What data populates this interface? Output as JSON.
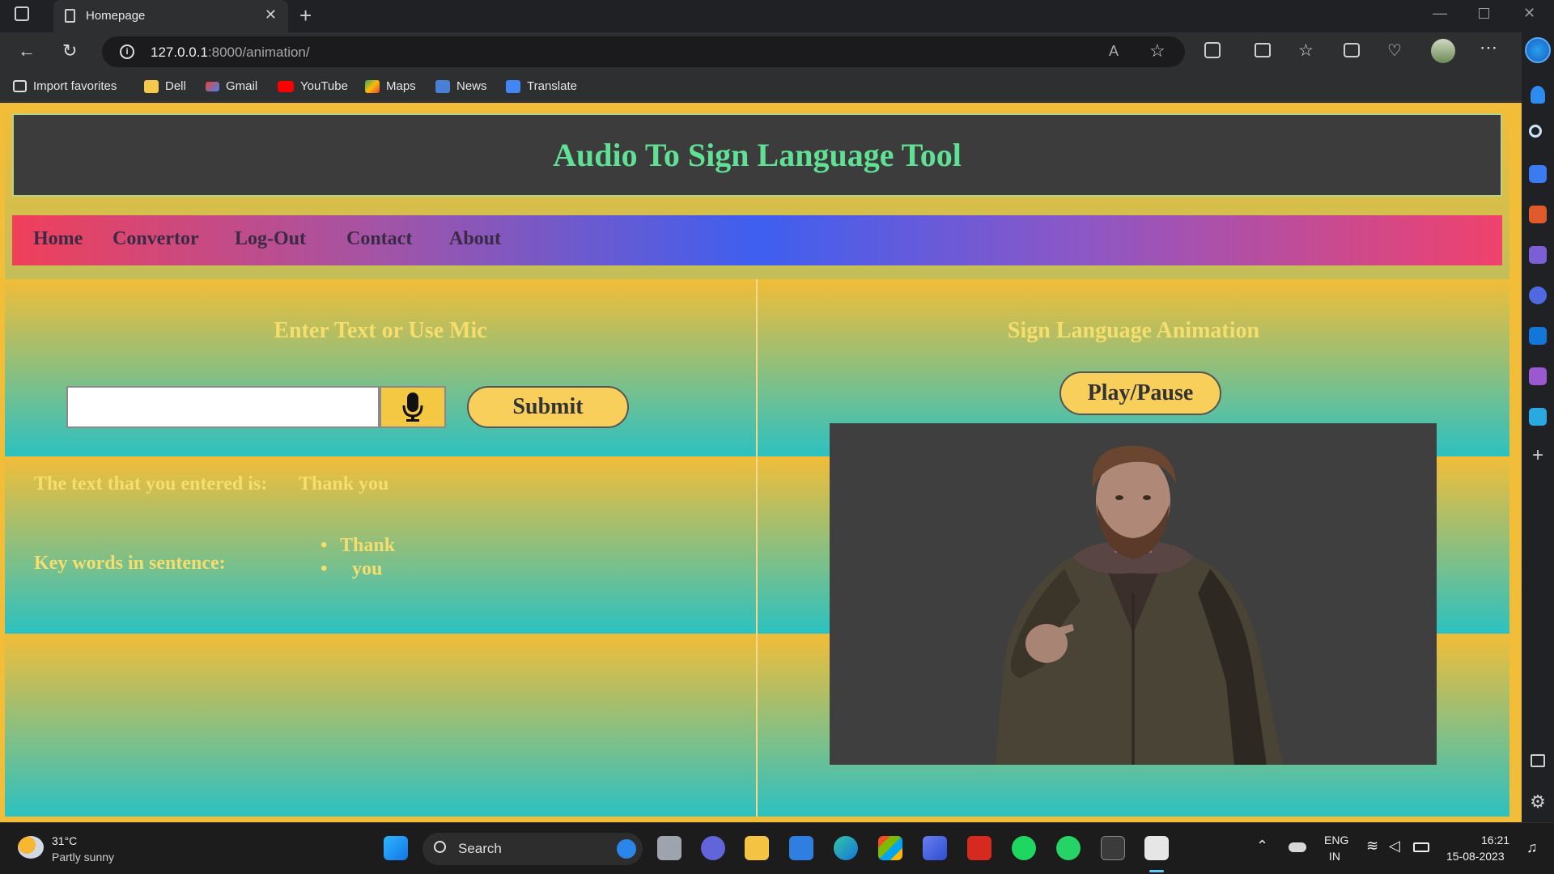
{
  "browser": {
    "tab_title": "Homepage",
    "url_host": "127.0.0.1",
    "url_path": ":8000/animation/",
    "bookmarks": [
      "Import favorites",
      "Dell",
      "Gmail",
      "YouTube",
      "Maps",
      "News",
      "Translate"
    ]
  },
  "site": {
    "title": "Audio To Sign Language Tool",
    "nav": [
      "Home",
      "Convertor",
      "Log-Out",
      "Contact",
      "About"
    ]
  },
  "left_panel": {
    "title": "Enter Text or Use Mic",
    "input_value": "",
    "submit_label": "Submit",
    "entered_label": "The text that you entered is:",
    "entered_text": "Thank you",
    "keywords_label": "Key words in sentence:",
    "keywords": [
      "Thank",
      "you"
    ]
  },
  "right_panel": {
    "title": "Sign Language Animation",
    "play_label": "Play/Pause"
  },
  "taskbar": {
    "temperature": "31°C",
    "weather": "Partly sunny",
    "search_label": "Search",
    "lang": "ENG",
    "region": "IN",
    "time": "16:21",
    "date": "15-08-2023"
  },
  "colors": {
    "page_gold": "#f2bd38",
    "page_teal": "#2cc1c1",
    "title_green": "#5fe094",
    "label_yellow": "#f6de6e",
    "button_yellow": "#f8cf5a"
  }
}
